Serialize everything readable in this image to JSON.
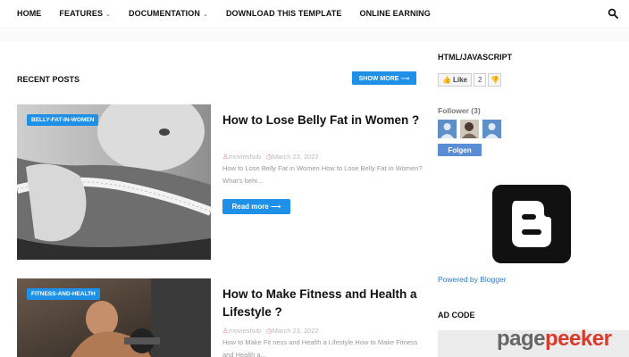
{
  "nav": {
    "items": [
      {
        "label": "HOME",
        "dropdown": false
      },
      {
        "label": "FEATURES",
        "dropdown": true
      },
      {
        "label": "DOCUMENTATION",
        "dropdown": true
      },
      {
        "label": "DOWNLOAD THIS TEMPLATE",
        "dropdown": false
      },
      {
        "label": "ONLINE EARNING",
        "dropdown": false
      }
    ],
    "search_icon": "search-icon"
  },
  "main": {
    "section_title": "RECENT POSTS",
    "show_more_label": "SHOW MORE ⟶",
    "posts": [
      {
        "badge": "BELLY-FAT-IN-WOMEN",
        "title": "How to Lose Belly Fat in Women ?",
        "author": "movieshub",
        "date": "March 23, 2022",
        "excerpt": "How to Lose Belly Fat in Women How to Lose Belly Fat in Women? What's behi...",
        "read_more": "Read more ⟶"
      },
      {
        "badge": "FITNESS-AND-HEALTH",
        "title": "How to Make Fitness and Health a Lifestyle ?",
        "author": "movieshub",
        "date": "March 23, 2022",
        "excerpt": "How to Make Fit ness and Health a Lifestyle How to Make Fitness and Health a..."
      }
    ]
  },
  "sidebar": {
    "html_title": "HTML/JAVASCRIPT",
    "like_label": "Like",
    "like_count": "2",
    "follower_title": "Follower (3)",
    "follow_label": "Folgen",
    "powered_by": "Powered by Blogger",
    "ad_title": "AD CODE"
  },
  "watermark": {
    "part1": "page",
    "part2": "peeker"
  },
  "colors": {
    "accent": "#1e90e8",
    "meta_red": "#e87d7d",
    "follow_blue": "#5b8dd6",
    "link_blue": "#2a7ad9"
  }
}
